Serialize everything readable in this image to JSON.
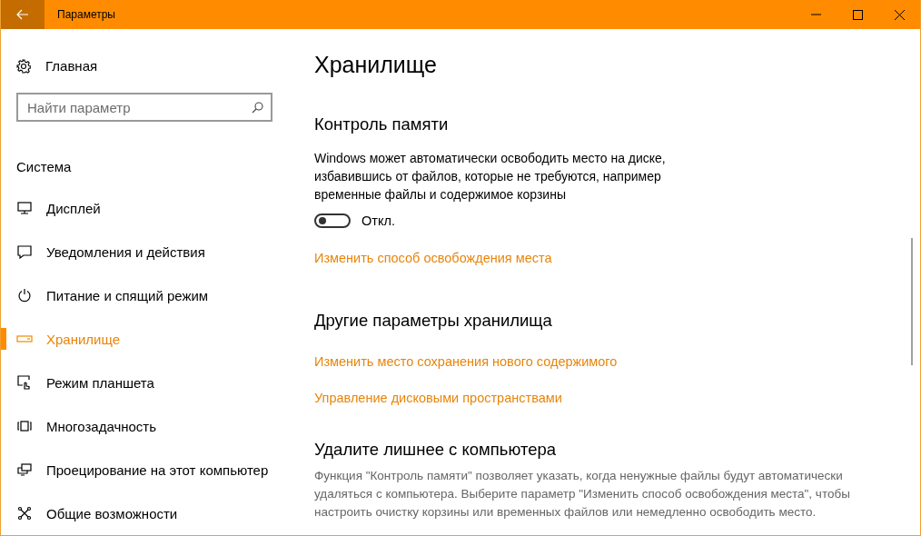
{
  "window": {
    "title": "Параметры"
  },
  "sidebar": {
    "home": "Главная",
    "search": {
      "placeholder": "Найти параметр"
    },
    "section": "Система",
    "items": [
      {
        "label": "Дисплей",
        "selected": false
      },
      {
        "label": "Уведомления и действия",
        "selected": false
      },
      {
        "label": "Питание и спящий режим",
        "selected": false
      },
      {
        "label": "Хранилище",
        "selected": true
      },
      {
        "label": "Режим планшета",
        "selected": false
      },
      {
        "label": "Многозадачность",
        "selected": false
      },
      {
        "label": "Проецирование на этот компьютер",
        "selected": false
      },
      {
        "label": "Общие возможности",
        "selected": false
      }
    ]
  },
  "content": {
    "title": "Хранилище",
    "sections": [
      {
        "heading": "Контроль памяти",
        "description": "Windows может автоматически освободить место на диске, избавившись от файлов, которые не требуются, например временные файлы и содержимое корзины",
        "toggle": {
          "on": false,
          "label": "Откл."
        },
        "links": [
          "Изменить способ освобождения места"
        ]
      },
      {
        "heading": "Другие параметры хранилища",
        "links": [
          "Изменить место сохранения нового содержимого",
          "Управление дисковыми пространствами"
        ]
      },
      {
        "heading": "Удалите лишнее с компьютера",
        "note": "Функция \"Контроль памяти\" позволяет указать, когда ненужные файлы будут автоматически удаляться с компьютера. Выберите параметр \"Изменить способ освобождения места\", чтобы настроить очистку корзины или временных файлов или немедленно освободить место."
      }
    ]
  }
}
